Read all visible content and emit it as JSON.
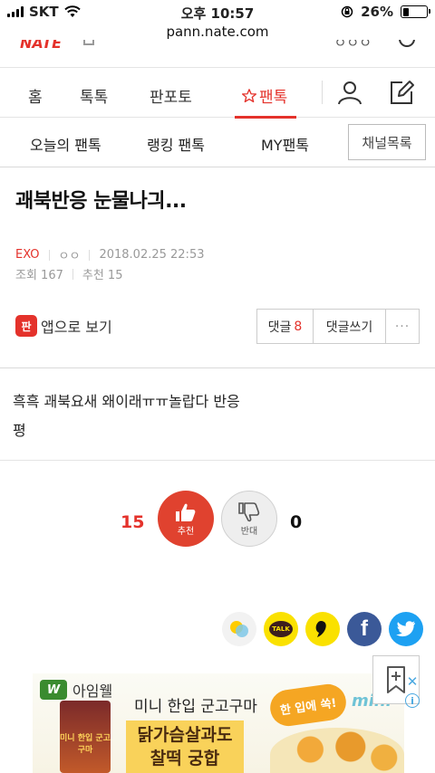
{
  "status_bar": {
    "carrier": "SKT",
    "time": "오후 10:57",
    "battery": "26%",
    "battery_level": 0.26
  },
  "browser": {
    "url": "pann.nate.com"
  },
  "main_nav": {
    "tabs": [
      {
        "label": "홈"
      },
      {
        "label": "톡톡"
      },
      {
        "label": "판포토"
      },
      {
        "label": "팬톡",
        "active": true
      }
    ]
  },
  "sub_nav": {
    "items": [
      "오늘의 팬톡",
      "랭킹 팬톡",
      "MY팬톡"
    ],
    "channel_button": "채널목록"
  },
  "post": {
    "title": "괘북반응 눈물나긔...",
    "author": "EXO",
    "nickname": "ㅇㅇ",
    "datetime": "2018.02.25 22:53",
    "views": "조회 167",
    "recommends": "추천 15",
    "app_link": "앱으로 보기",
    "app_icon_text": "판",
    "comment_label": "댓글",
    "comment_count": "8",
    "write_comment": "댓글쓰기",
    "more": "···",
    "body_lines": [
      "흑흑 괘북요새 왜이래ㅠㅠ놀랍다 반응",
      "평"
    ]
  },
  "vote": {
    "up_count": "15",
    "up_label": "추천",
    "down_count": "0",
    "down_label": "반대"
  },
  "share": {
    "icons": [
      "kakaostory-icon",
      "kakaotalk-icon",
      "band-icon",
      "facebook-icon",
      "twitter-icon"
    ],
    "talk_label": "TALK",
    "facebook_glyph": "f"
  },
  "ad": {
    "brand": "아임웰",
    "logo_glyph": "W",
    "line1": "미니 한입 군고구마",
    "bubble": "한 입에 쏙!",
    "mini": "mini",
    "box_line1": "닭가슴살과도",
    "box_line2": "찰떡 궁합",
    "product_label": "미니 한입 군고구마",
    "close_glyph": "✕",
    "info_glyph": "i"
  },
  "colors": {
    "accent": "#e4322b",
    "kakao_yellow": "#fae100",
    "facebook": "#3b5998",
    "twitter": "#1da1f2"
  }
}
